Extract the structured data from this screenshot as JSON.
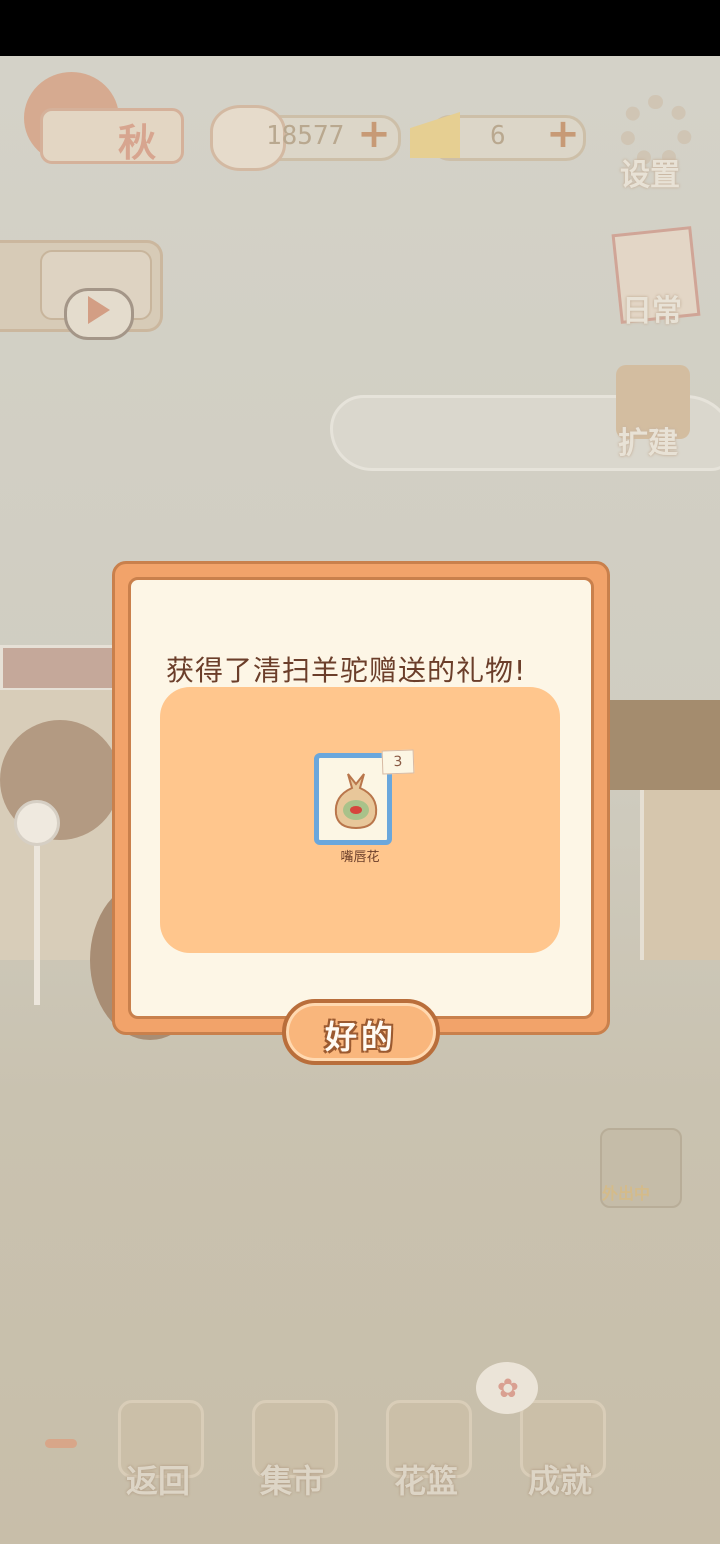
{
  "hud": {
    "season_label": "秋",
    "fish_count": "18577",
    "cheese_count": "6",
    "plus_symbol": "+"
  },
  "side_menu": {
    "settings": "设置",
    "daily": "日常",
    "expand": "扩建",
    "map": "外出中"
  },
  "bottom_nav": {
    "items": [
      {
        "label": "返回",
        "icon": "window-icon"
      },
      {
        "label": "集市",
        "icon": "market-stall-icon"
      },
      {
        "label": "花篮",
        "icon": "flower-basket-icon"
      },
      {
        "label": "成就",
        "icon": "trophy-icon"
      }
    ]
  },
  "dialog": {
    "title": "获得了清扫羊驼赠送的礼物!",
    "item": {
      "name": "嘴唇花",
      "count": "3",
      "icon": "seed-bag-icon"
    },
    "ok_label": "好的"
  },
  "colors": {
    "dialog_border": "#f2a36a",
    "dialog_bg": "#fdf6e6",
    "reward_panel": "#ffc68d",
    "item_frame": "#6aa7dc",
    "title_text": "#6b3e2a"
  }
}
